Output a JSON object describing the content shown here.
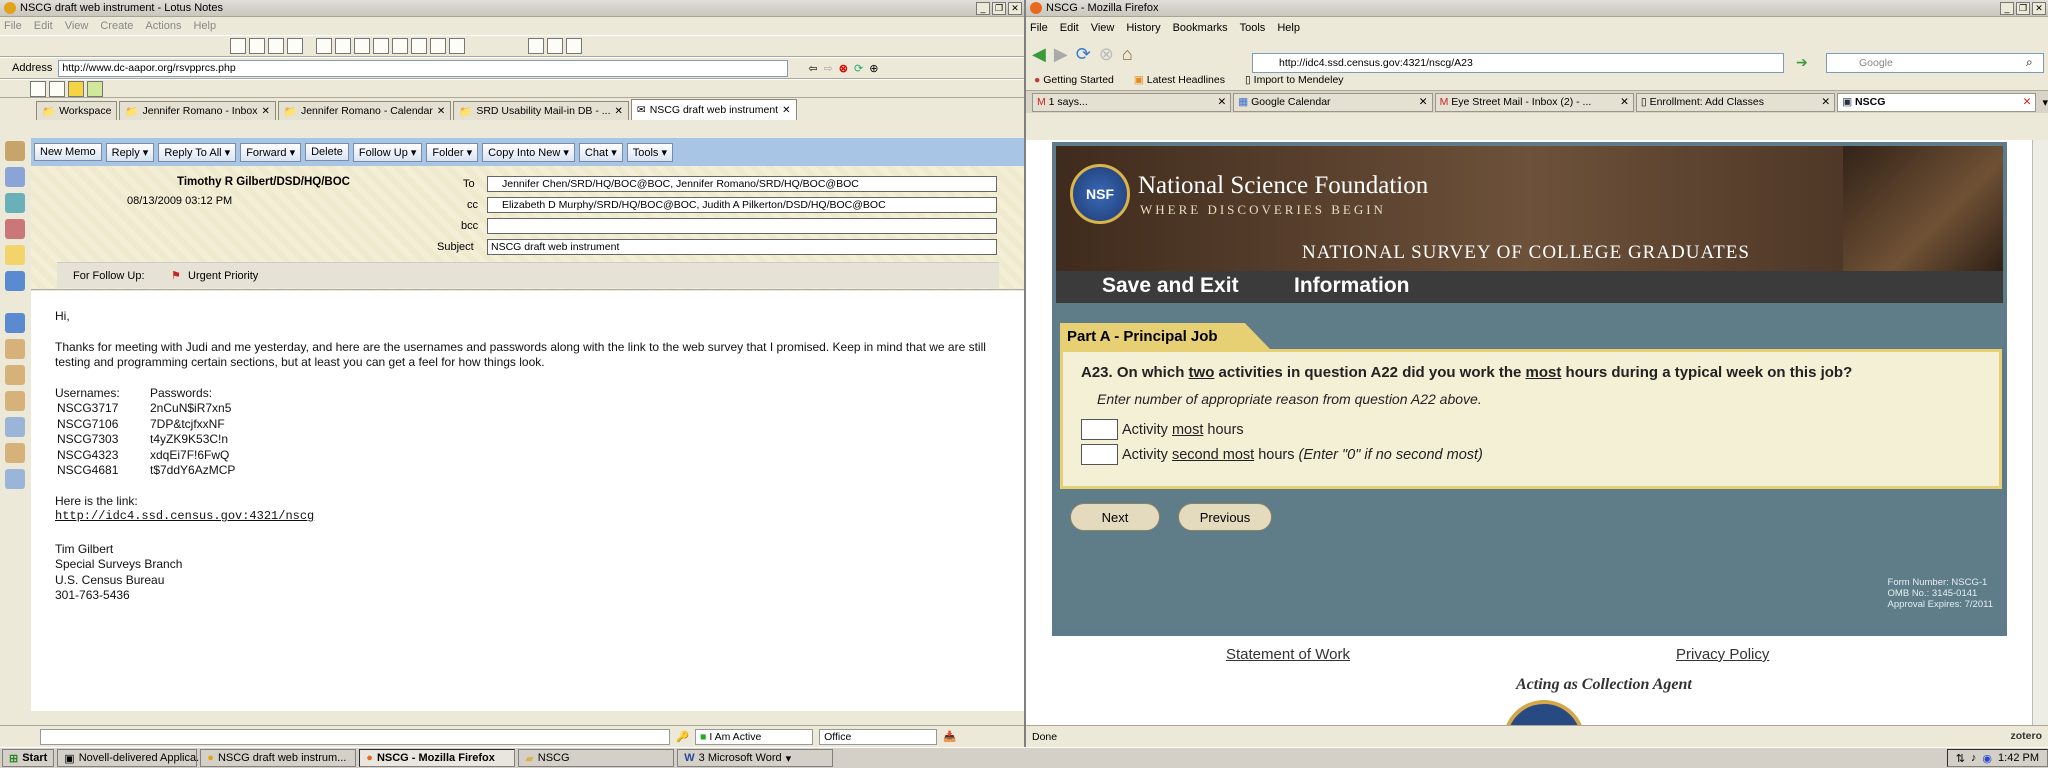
{
  "lotus": {
    "title": "NSCG draft web instrument - Lotus Notes",
    "menu": [
      "File",
      "Edit",
      "View",
      "Create",
      "Actions",
      "Help"
    ],
    "address_label": "Address",
    "address_value": "http://www.dc-aapor.org/rsvpprcs.php",
    "tabs": [
      {
        "label": "Workspace"
      },
      {
        "label": "Jennifer Romano - Inbox"
      },
      {
        "label": "Jennifer Romano - Calendar"
      },
      {
        "label": "SRD Usability Mail-in DB - ..."
      },
      {
        "label": "NSCG draft web instrument"
      }
    ],
    "actions": [
      "New Memo",
      "Reply",
      "Reply To All",
      "Forward",
      "Delete",
      "Follow Up",
      "Folder",
      "Copy Into New",
      "Chat",
      "Tools"
    ],
    "header": {
      "from": "Timothy R Gilbert/DSD/HQ/BOC",
      "date": "08/13/2009 03:12 PM",
      "to_label": "To",
      "to": "Jennifer Chen/SRD/HQ/BOC@BOC,      Jennifer Romano/SRD/HQ/BOC@BOC",
      "cc_label": "cc",
      "cc": "Elizabeth D Murphy/SRD/HQ/BOC@BOC,      Judith A Pilkerton/DSD/HQ/BOC@BOC",
      "bcc_label": "bcc",
      "bcc": "",
      "subject_label": "Subject",
      "subject": "NSCG draft web instrument",
      "followup_label": "For Follow Up:",
      "priority": "Urgent Priority"
    },
    "body": {
      "greeting": "Hi,",
      "para": "Thanks for meeting with Judi and me yesterday, and here are the usernames and passwords along with the link to the web survey that I promised.  Keep in mind that we are still testing and programming certain sections, but at least you can get a feel for how things look.",
      "usernames_label": "Usernames:",
      "passwords_label": "Passwords:",
      "creds": [
        {
          "user": "NSCG3717",
          "pass": "2nCuN$iR7xn5"
        },
        {
          "user": "NSCG7106",
          "pass": "7DP&tcjfxxNF"
        },
        {
          "user": "NSCG7303",
          "pass": "t4yZK9K53C!n"
        },
        {
          "user": "NSCG4323",
          "pass": "xdqEi7F!6FwQ"
        },
        {
          "user": "NSCG4681",
          "pass": "t$7ddY6AzMCP"
        }
      ],
      "link_label": "Here is the link:",
      "link": "http://idc4.ssd.census.gov:4321/nscg",
      "sig": [
        "Tim Gilbert",
        "Special Surveys Branch",
        "U.S. Census Bureau",
        "301-763-5436"
      ]
    },
    "status": {
      "active": "I Am Active",
      "location": "Office"
    }
  },
  "firefox": {
    "title": "NSCG - Mozilla Firefox",
    "menu": [
      "File",
      "Edit",
      "View",
      "History",
      "Bookmarks",
      "Tools",
      "Help"
    ],
    "url": "http://idc4.ssd.census.gov:4321/nscg/A23",
    "search_placeholder": "Google",
    "bookmarks": [
      "Getting Started",
      "Latest Headlines",
      "Import to Mendeley"
    ],
    "tabs": [
      {
        "label": "1 says..."
      },
      {
        "label": "Google Calendar"
      },
      {
        "label": "Eye Street Mail - Inbox (2) - ..."
      },
      {
        "label": "Enrollment: Add Classes"
      },
      {
        "label": "NSCG"
      }
    ],
    "page": {
      "nsf_name": "National Science Foundation",
      "nsf_tagline": "WHERE DISCOVERIES BEGIN",
      "nsf_logo": "NSF",
      "survey_name": "NATIONAL SURVEY OF COLLEGE GRADUATES",
      "nav_save": "Save and Exit",
      "nav_info": "Information",
      "section": "Part A - Principal Job",
      "q_pre": "A23. On which ",
      "q_two": "two",
      "q_mid": " activities in question A22 did you work the ",
      "q_most": "most",
      "q_post": " hours during a typical week on this job?",
      "instruction": "Enter number of appropriate reason from question A22 above.",
      "row1_pre": "Activity ",
      "row1_u": "most",
      "row1_post": " hours",
      "row2_pre": "Activity ",
      "row2_u": "second most",
      "row2_post": " hours ",
      "row2_note": "(Enter \"0\" if no second most)",
      "next": "Next",
      "previous": "Previous",
      "form_number": "Form Number: NSCG-1",
      "omb": "OMB No.: 3145-0141",
      "approval": "Approval Expires: 7/2011",
      "statement": "Statement of Work",
      "privacy": "Privacy Policy",
      "agent": "Acting as Collection Agent"
    },
    "status": "Done",
    "zotero": "zotero"
  },
  "taskbar": {
    "start": "Start",
    "items": [
      {
        "label": "Novell-delivered Applica..."
      },
      {
        "label": "NSCG draft web instrum..."
      },
      {
        "label": "NSCG - Mozilla Firefox"
      },
      {
        "label": "NSCG"
      },
      {
        "label": "3 Microsoft Word"
      }
    ],
    "time": "1:42 PM"
  }
}
